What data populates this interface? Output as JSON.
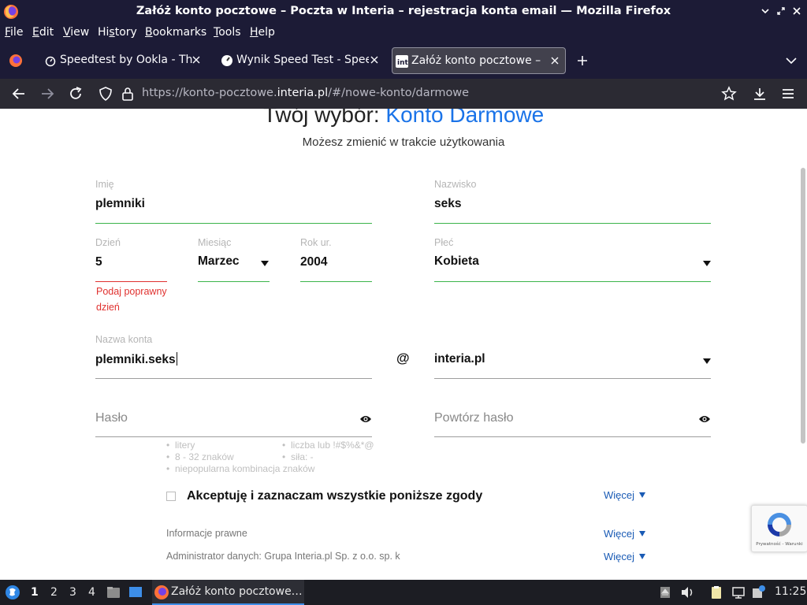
{
  "window": {
    "title": "Załóż konto pocztowe – Poczta w Interia – rejestracja konta email — Mozilla Firefox"
  },
  "menu": {
    "items": [
      {
        "label": "File",
        "underline": "F",
        "rest": "ile"
      },
      {
        "label": "Edit",
        "underline": "E",
        "rest": "dit"
      },
      {
        "label": "View",
        "underline": "V",
        "rest": "iew"
      },
      {
        "label": "History",
        "underline": "H",
        "rest": "istory",
        "prefix": ""
      },
      {
        "label": "Bookmarks",
        "underline": "B",
        "rest": "ookmarks"
      },
      {
        "label": "Tools",
        "underline": "T",
        "rest": "ools"
      },
      {
        "label": "Help",
        "underline": "H",
        "rest": "elp"
      }
    ]
  },
  "tabs": [
    {
      "label": "Speedtest by Ookla - The",
      "icon": "speedtest-icon",
      "active": false
    },
    {
      "label": "Wynik Speed Test - Speed",
      "icon": "speedometer-icon",
      "active": false
    },
    {
      "label": "Załóż konto pocztowe – P",
      "icon": "interia-icon",
      "active": true
    }
  ],
  "nav": {
    "url_prefix": "https://konto-pocztowe.",
    "url_host": "interia.pl",
    "url_suffix": "/#/nowe-konto/darmowe"
  },
  "page": {
    "heading_start": "Twój wybór: ",
    "heading_accent": "Konto Darmowe",
    "subheading": "Możesz zmienić w trakcie użytkowania",
    "fields": {
      "first_name": {
        "label": "Imię",
        "value": "plemniki"
      },
      "last_name": {
        "label": "Nazwisko",
        "value": "seks"
      },
      "day": {
        "label": "Dzień",
        "value": "5"
      },
      "month": {
        "label": "Miesiąc",
        "value": "Marzec"
      },
      "year": {
        "label": "Rok ur.",
        "value": "2004"
      },
      "gender": {
        "label": "Płeć",
        "value": "Kobieta"
      },
      "account": {
        "label": "Nazwa konta",
        "value": "plemniki.seks"
      },
      "domain": {
        "value": "interia.pl"
      },
      "password": {
        "placeholder": "Hasło"
      },
      "password_repeat": {
        "placeholder": "Powtórz hasło"
      }
    },
    "day_error": "Podaj poprawny dzień",
    "at_sign": "@",
    "password_hints": {
      "letters": "litery",
      "length": "8 - 32 znaków",
      "digit_or_symbol": "liczba lub !#$%&*@",
      "strength": "siła: -",
      "uncommon": "niepopularna kombinacja znaków"
    },
    "consent_all": "Akceptuję i zaznaczam wszystkie poniższe zgody",
    "more_label": "Więcej",
    "legal_info": "Informacje prawne",
    "admin_info": "Administrator danych: Grupa Interia.pl Sp. z o.o. sp. k",
    "recaptcha_text": "Prywatność - Warunki"
  },
  "taskbar": {
    "workspaces": [
      "1",
      "2",
      "3",
      "4"
    ],
    "active_window": "Załóż konto pocztowe…",
    "clock": "11:25"
  },
  "colors": {
    "chrome_dark": "#1c1b36",
    "accent_blue": "#1a73e8",
    "valid_green": "#3bb44a",
    "error_red": "#e0312f"
  }
}
